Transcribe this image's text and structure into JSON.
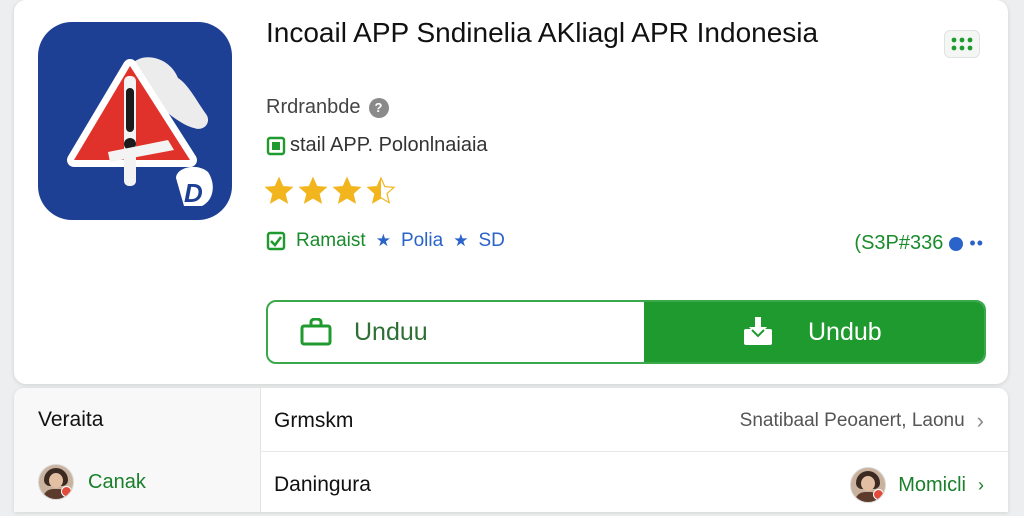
{
  "app": {
    "title": "Incoail APP Sndinelia AKliagl APR Indonesia",
    "developer": "Rrdranbde",
    "category": "stail APP. Polonlnaiaia",
    "rating_stars": 3.5,
    "rating_max": 5,
    "badge_text": "Ramaist",
    "badge_tag_1": "Polia",
    "badge_tag_2": "SD",
    "price": "(S3P#336",
    "icon_badge_text": "D"
  },
  "buttons": {
    "secondary_label": "Unduu",
    "primary_label": "Undub"
  },
  "details": {
    "heading": "Veraita",
    "user_name": "Canak",
    "rows": [
      {
        "label": "Grmskm",
        "value": "Snatibaal Peoanert, Laonu"
      },
      {
        "label": "Daningura",
        "user": "Momicli"
      }
    ]
  },
  "colors": {
    "brand_green": "#1f9a2e",
    "icon_blue": "#1d3f94",
    "warning_red": "#e0322a",
    "star_gold": "#f2b51d",
    "accent_blue": "#2a63c9"
  },
  "icons": [
    "grid-icon",
    "info-icon",
    "category-icon",
    "star-icon",
    "check-icon",
    "bag-icon",
    "download-icon",
    "chevron-right-icon",
    "warning-icon"
  ]
}
